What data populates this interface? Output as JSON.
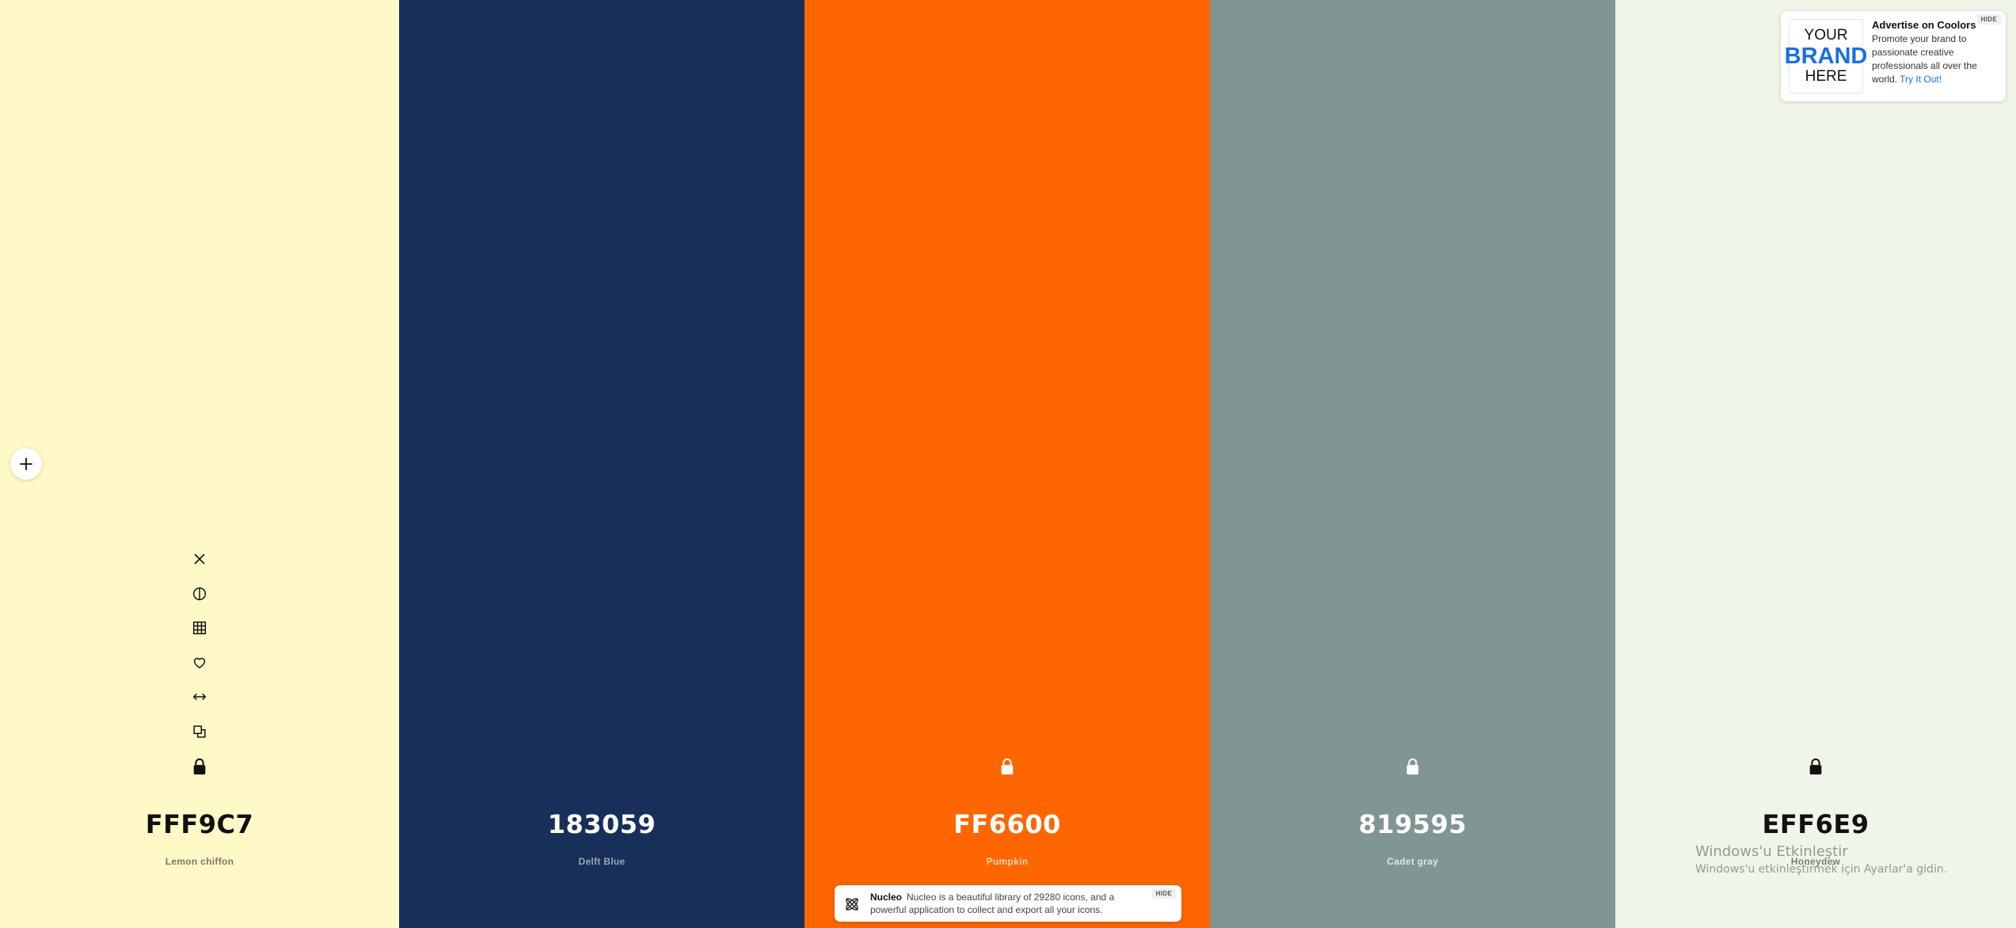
{
  "palette": {
    "swatches": [
      {
        "hex": "FFF9C7",
        "name": "Lemon chiffon",
        "bg": "#FFF9C7",
        "fg": "#111111",
        "name_color": "#7a766a",
        "locked": true
      },
      {
        "hex": "183059",
        "name": "Delft Blue",
        "bg": "#183059",
        "fg": "#ffffff",
        "name_color": "#9aa6bd",
        "locked": false
      },
      {
        "hex": "FF6600",
        "name": "Pumpkin",
        "bg": "#FF6600",
        "fg": "#ffffff",
        "name_color": "#ffd2b0",
        "locked": true
      },
      {
        "hex": "819595",
        "name": "Cadet gray",
        "bg": "#819595",
        "fg": "#ffffff",
        "name_color": "#dfe6e6",
        "locked": true
      },
      {
        "hex": "EFF6E9",
        "name": "Honeydew",
        "bg": "#EFF6E9",
        "fg": "#111111",
        "name_color": "#7a7e76",
        "locked": true
      }
    ],
    "tool_icons": [
      "close-icon",
      "contrast-icon",
      "shades-grid-icon",
      "heart-icon",
      "drag-arrows-icon",
      "copy-icon"
    ]
  },
  "ad": {
    "brand_line1": "YOUR",
    "brand_line2": "BRAND",
    "brand_line3": "HERE",
    "title": "Advertise on Coolors",
    "text": "Promote your brand to passionate creative professionals all over the world.",
    "link": "Try It Out!",
    "hide_label": "HIDE"
  },
  "toast": {
    "title": "Nucleo",
    "text": "Nucleo is a beautiful library of 29280 icons, and a powerful application to collect and export all your icons.",
    "hide_label": "HIDE"
  },
  "windows_activation": {
    "line1": "Windows'u Etkinleştir",
    "line2": "Windows'u etkinleştirmek için Ayarlar'a gidin."
  }
}
